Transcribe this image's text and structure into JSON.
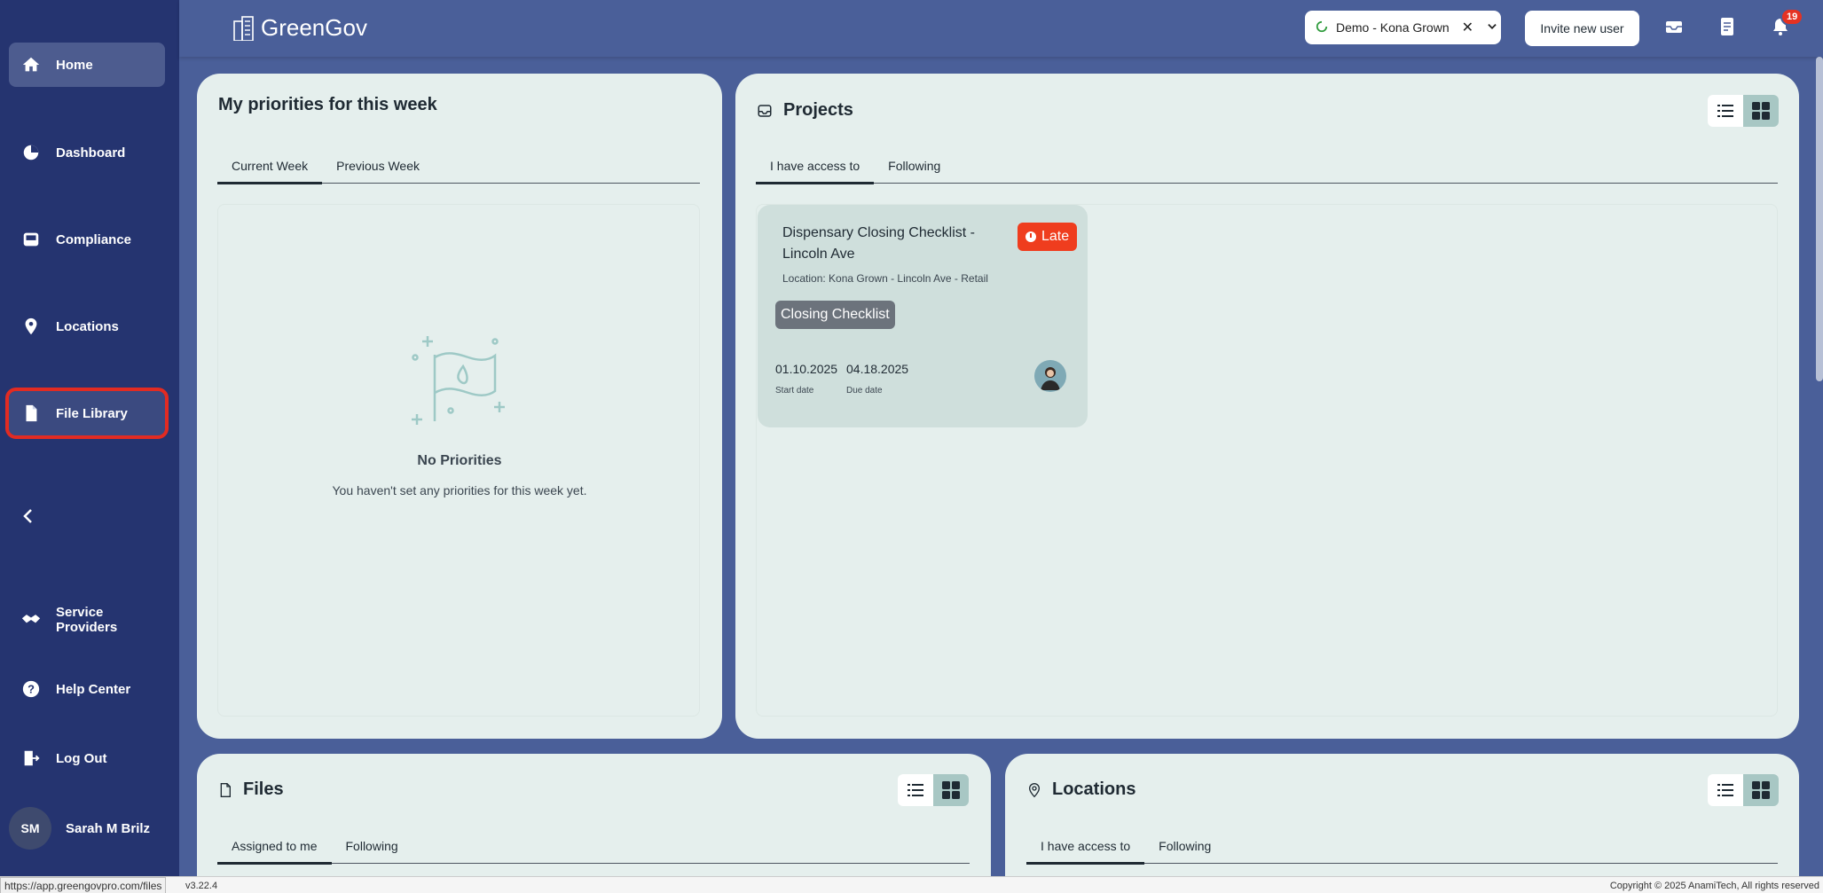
{
  "sidebar": {
    "items": [
      {
        "label": "Home",
        "icon": "home-icon"
      },
      {
        "label": "Dashboard",
        "icon": "pie-chart-icon"
      },
      {
        "label": "Compliance",
        "icon": "inbox-icon"
      },
      {
        "label": "Locations",
        "icon": "map-pin-icon"
      },
      {
        "label": "File Library",
        "icon": "file-icon"
      },
      {
        "label": "Service Providers",
        "icon": "handshake-icon"
      },
      {
        "label": "Help Center",
        "icon": "help-icon"
      },
      {
        "label": "Log Out",
        "icon": "logout-icon"
      }
    ],
    "user": {
      "initials": "SM",
      "name": "Sarah M Brilz"
    }
  },
  "header": {
    "brand": "GreenGov",
    "company": "Demo - Kona Grown",
    "invite_label": "Invite new user",
    "notification_count": "19"
  },
  "priorities": {
    "title": "My priorities for this week",
    "tabs": [
      "Current Week",
      "Previous Week"
    ],
    "empty_title": "No Priorities",
    "empty_subtitle": "You haven't set any priorities for this week yet."
  },
  "projects": {
    "title": "Projects",
    "tabs": [
      "I have access to",
      "Following"
    ],
    "items": [
      {
        "title": "Dispensary Closing Checklist - Lincoln Ave",
        "status": "Late",
        "location": "Location: Kona Grown - Lincoln Ave - Retail",
        "tag": "Closing Checklist",
        "start_date": "01.10.2025",
        "start_label": "Start date",
        "due_date": "04.18.2025",
        "due_label": "Due date"
      }
    ]
  },
  "files": {
    "title": "Files",
    "tabs": [
      "Assigned to me",
      "Following"
    ]
  },
  "locations": {
    "title": "Locations",
    "tabs": [
      "I have access to",
      "Following"
    ]
  },
  "status_bar": {
    "url": "https://app.greengovpro.com/files",
    "version": "v3.22.4",
    "copyright": "Copyright © 2025 AnamiTech, All rights reserved"
  },
  "colors": {
    "sidebar_bg": "#253470",
    "header_bg": "#4a5f99",
    "card_bg": "#e5efed",
    "late": "#ef3d1e",
    "highlight": "#e22b22"
  }
}
